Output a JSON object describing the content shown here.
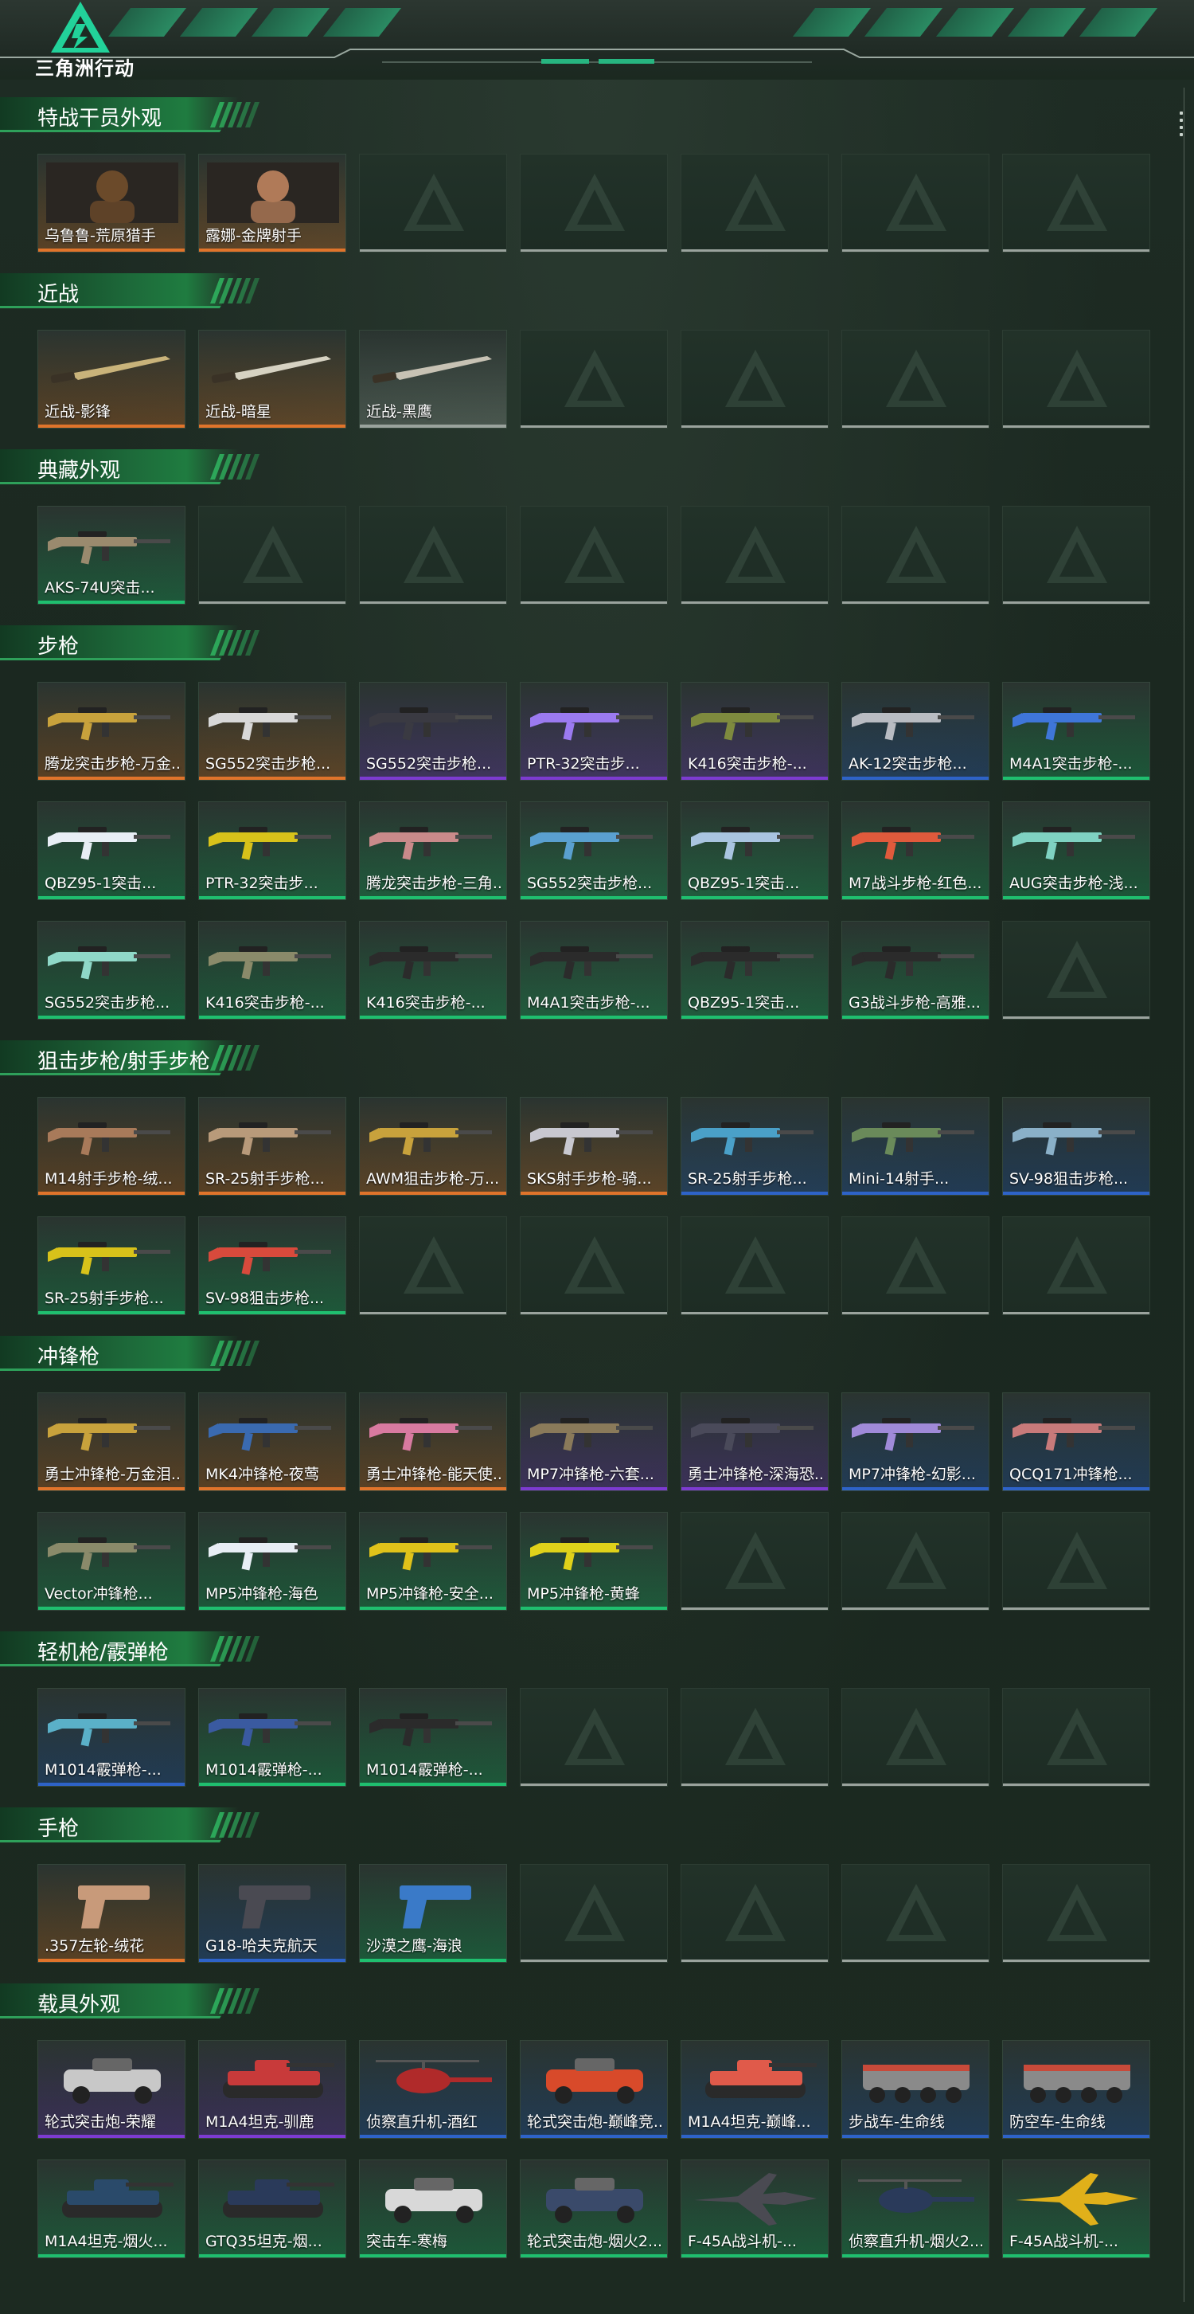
{
  "app": {
    "title": "三角洲行动"
  },
  "colors": {
    "gold": "#e0742b",
    "purple": "#7d3bd1",
    "blue": "#2e63c8",
    "green": "#1fbf6f",
    "empty": "#9aa39d"
  },
  "sections": [
    {
      "title": "特战干员外观",
      "rows": [
        [
          {
            "label": "乌鲁鲁-荒原猎手",
            "quality": "gold",
            "kind": "portrait",
            "color": "#6b4a2a"
          },
          {
            "label": "露娜-金牌射手",
            "quality": "gold",
            "kind": "portrait",
            "color": "#b07a58"
          },
          null,
          null,
          null,
          null,
          null
        ]
      ]
    },
    {
      "title": "近战",
      "rows": [
        [
          {
            "label": "近战-影锋",
            "quality": "gold",
            "kind": "knife",
            "color": "#c9b37a"
          },
          {
            "label": "近战-暗星",
            "quality": "gold",
            "kind": "knife",
            "color": "#d6d2c2"
          },
          {
            "label": "近战-黑鹰",
            "quality": "empty",
            "kind": "knife",
            "color": "#c7c2b4"
          },
          null,
          null,
          null,
          null
        ]
      ]
    },
    {
      "title": "典藏外观",
      "rows": [
        [
          {
            "label": "AKS-74U突击...",
            "quality": "green",
            "kind": "gun",
            "color": "#9a8a6e"
          },
          null,
          null,
          null,
          null,
          null,
          null
        ]
      ]
    },
    {
      "title": "步枪",
      "rows": [
        [
          {
            "label": "腾龙突击步枪-万金...",
            "quality": "gold",
            "kind": "gun",
            "color": "#c8a23c"
          },
          {
            "label": "SG552突击步枪...",
            "quality": "gold",
            "kind": "gun",
            "color": "#d8d8d8"
          },
          {
            "label": "SG552突击步枪...",
            "quality": "purple",
            "kind": "gun",
            "color": "#3a3a42"
          },
          {
            "label": "PTR-32突击步...",
            "quality": "purple",
            "kind": "gun",
            "color": "#9b7af0"
          },
          {
            "label": "K416突击步枪-...",
            "quality": "purple",
            "kind": "gun",
            "color": "#7e8a3e"
          },
          {
            "label": "AK-12突击步枪...",
            "quality": "blue",
            "kind": "gun",
            "color": "#b9bcc2"
          },
          {
            "label": "M4A1突击步枪-...",
            "quality": "green",
            "kind": "gun",
            "color": "#3f76d9"
          }
        ],
        [
          {
            "label": "QBZ95-1突击...",
            "quality": "green",
            "kind": "gun",
            "color": "#e8eef5"
          },
          {
            "label": "PTR-32突击步...",
            "quality": "green",
            "kind": "gun",
            "color": "#d8c21a"
          },
          {
            "label": "腾龙突击步枪-三角...",
            "quality": "green",
            "kind": "gun",
            "color": "#c98a8a"
          },
          {
            "label": "SG552突击步枪...",
            "quality": "green",
            "kind": "gun",
            "color": "#5aa0d0"
          },
          {
            "label": "QBZ95-1突击...",
            "quality": "green",
            "kind": "gun",
            "color": "#a9c4e0"
          },
          {
            "label": "M7战斗步枪-红色...",
            "quality": "green",
            "kind": "gun",
            "color": "#e05a3c"
          },
          {
            "label": "AUG突击步枪-浅...",
            "quality": "green",
            "kind": "gun",
            "color": "#7fd2c2"
          }
        ],
        [
          {
            "label": "SG552突击步枪...",
            "quality": "green",
            "kind": "gun",
            "color": "#8fd8c8"
          },
          {
            "label": "K416突击步枪-...",
            "quality": "green",
            "kind": "gun",
            "color": "#8a8a6a"
          },
          {
            "label": "K416突击步枪-...",
            "quality": "green",
            "kind": "gun",
            "color": "#2b2b2b"
          },
          {
            "label": "M4A1突击步枪-...",
            "quality": "green",
            "kind": "gun",
            "color": "#2b2b2b"
          },
          {
            "label": "QBZ95-1突击...",
            "quality": "green",
            "kind": "gun",
            "color": "#2b2b2b"
          },
          {
            "label": "G3战斗步枪-高雅...",
            "quality": "green",
            "kind": "gun",
            "color": "#2b2b2b"
          },
          null
        ]
      ]
    },
    {
      "title": "狙击步枪/射手步枪",
      "rows": [
        [
          {
            "label": "M14射手步枪-绒...",
            "quality": "gold",
            "kind": "gun",
            "color": "#a87a5a"
          },
          {
            "label": "SR-25射手步枪...",
            "quality": "gold",
            "kind": "gun",
            "color": "#b89a7a"
          },
          {
            "label": "AWM狙击步枪-万...",
            "quality": "gold",
            "kind": "gun",
            "color": "#c8a23c"
          },
          {
            "label": "SKS射手步枪-骑...",
            "quality": "gold",
            "kind": "gun",
            "color": "#c8c8d0"
          },
          {
            "label": "SR-25射手步枪...",
            "quality": "blue",
            "kind": "gun",
            "color": "#4aa0c8"
          },
          {
            "label": "Mini-14射手...",
            "quality": "blue",
            "kind": "gun",
            "color": "#6a8a5a"
          },
          {
            "label": "SV-98狙击步枪...",
            "quality": "blue",
            "kind": "gun",
            "color": "#8ab0c8"
          }
        ],
        [
          {
            "label": "SR-25射手步枪...",
            "quality": "green",
            "kind": "gun",
            "color": "#d8c21a"
          },
          {
            "label": "SV-98狙击步枪...",
            "quality": "green",
            "kind": "gun",
            "color": "#d84a3c"
          },
          null,
          null,
          null,
          null,
          null
        ]
      ]
    },
    {
      "title": "冲锋枪",
      "rows": [
        [
          {
            "label": "勇士冲锋枪-万金泪...",
            "quality": "gold",
            "kind": "gun",
            "color": "#c8a23c"
          },
          {
            "label": "MK4冲锋枪-夜莺",
            "quality": "gold",
            "kind": "gun",
            "color": "#3a6ab0"
          },
          {
            "label": "勇士冲锋枪-能天使...",
            "quality": "gold",
            "kind": "gun",
            "color": "#d87aa0"
          },
          {
            "label": "MP7冲锋枪-六套...",
            "quality": "purple",
            "kind": "gun",
            "color": "#8a7a5a"
          },
          {
            "label": "勇士冲锋枪-深海恐...",
            "quality": "purple",
            "kind": "gun",
            "color": "#4a4a5a"
          },
          {
            "label": "MP7冲锋枪-幻影...",
            "quality": "blue",
            "kind": "gun",
            "color": "#a08ad8"
          },
          {
            "label": "QCQ171冲锋枪...",
            "quality": "blue",
            "kind": "gun",
            "color": "#c87a7a"
          }
        ],
        [
          {
            "label": "Vector冲锋枪...",
            "quality": "green",
            "kind": "gun",
            "color": "#8a8a6a"
          },
          {
            "label": "MP5冲锋枪-海色",
            "quality": "green",
            "kind": "gun",
            "color": "#e8eef5"
          },
          {
            "label": "MP5冲锋枪-安全...",
            "quality": "green",
            "kind": "gun",
            "color": "#e0c21a"
          },
          {
            "label": "MP5冲锋枪-黄蜂",
            "quality": "green",
            "kind": "gun",
            "color": "#e0d21a"
          },
          null,
          null,
          null
        ]
      ]
    },
    {
      "title": "轻机枪/霰弹枪",
      "rows": [
        [
          {
            "label": "M1014霰弹枪-...",
            "quality": "blue",
            "kind": "gun",
            "color": "#5ab0c8"
          },
          {
            "label": "M1014霰弹枪-...",
            "quality": "green",
            "kind": "gun",
            "color": "#3a5aa0"
          },
          {
            "label": "M1014霰弹枪-...",
            "quality": "green",
            "kind": "gun",
            "color": "#2b2b2b"
          },
          null,
          null,
          null,
          null
        ]
      ]
    },
    {
      "title": "手枪",
      "rows": [
        [
          {
            "label": ".357左轮-绒花",
            "quality": "gold",
            "kind": "pistol",
            "color": "#c89a7a"
          },
          {
            "label": "G18-哈夫克航天",
            "quality": "blue",
            "kind": "pistol",
            "color": "#4a4a52"
          },
          {
            "label": "沙漠之鹰-海浪",
            "quality": "green",
            "kind": "pistol",
            "color": "#3a7ac8"
          },
          null,
          null,
          null,
          null
        ]
      ]
    },
    {
      "title": "载具外观",
      "rows": [
        [
          {
            "label": "轮式突击炮-荣耀",
            "quality": "purple",
            "kind": "vehicle",
            "color": "#c8c8c8"
          },
          {
            "label": "M1A4坦克-驯鹿",
            "quality": "purple",
            "kind": "tank",
            "color": "#c83a3a"
          },
          {
            "label": "侦察直升机-酒红",
            "quality": "blue",
            "kind": "heli",
            "color": "#b02a2a"
          },
          {
            "label": "轮式突击炮-巅峰竞...",
            "quality": "blue",
            "kind": "vehicle",
            "color": "#d84a2a"
          },
          {
            "label": "M1A4坦克-巅峰...",
            "quality": "blue",
            "kind": "tank",
            "color": "#e05a4a"
          },
          {
            "label": "步战车-生命线",
            "quality": "blue",
            "kind": "apc",
            "color": "#c84a3a"
          },
          {
            "label": "防空车-生命线",
            "quality": "blue",
            "kind": "apc",
            "color": "#c84a3a"
          }
        ],
        [
          {
            "label": "M1A4坦克-烟火...",
            "quality": "green",
            "kind": "tank",
            "color": "#2a4a6a"
          },
          {
            "label": "GTQ35坦克-烟...",
            "quality": "green",
            "kind": "tank",
            "color": "#2a3a5a"
          },
          {
            "label": "突击车-寒梅",
            "quality": "green",
            "kind": "vehicle",
            "color": "#d8d8d8"
          },
          {
            "label": "轮式突击炮-烟火2...",
            "quality": "green",
            "kind": "vehicle",
            "color": "#3a4a6a"
          },
          {
            "label": "F-45A战斗机-...",
            "quality": "green",
            "kind": "jet",
            "color": "#4a4a52"
          },
          {
            "label": "侦察直升机-烟火2...",
            "quality": "green",
            "kind": "heli",
            "color": "#2a3a5a"
          },
          {
            "label": "F-45A战斗机-...",
            "quality": "green",
            "kind": "jet",
            "color": "#e0b01a"
          }
        ]
      ]
    }
  ]
}
